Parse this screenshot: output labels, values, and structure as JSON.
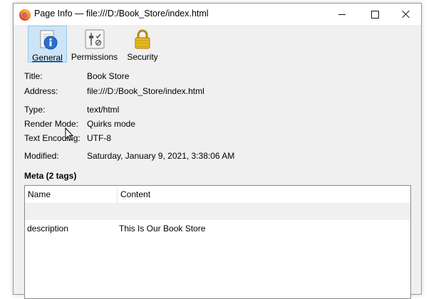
{
  "window": {
    "title": "Page Info — file:///D:/Book_Store/index.html"
  },
  "tabs": [
    {
      "label": "General",
      "icon": "info-icon",
      "selected": true
    },
    {
      "label": "Permissions",
      "icon": "permissions-icon",
      "selected": false
    },
    {
      "label": "Security",
      "icon": "lock-icon",
      "selected": false
    }
  ],
  "general": {
    "title_label": "Title:",
    "title_value": "Book Store",
    "address_label": "Address:",
    "address_value": "file:///D:/Book_Store/index.html",
    "type_label": "Type:",
    "type_value": "text/html",
    "render_label": "Render Mode:",
    "render_value": "Quirks mode",
    "encoding_label": "Text Encoding:",
    "encoding_value": "UTF-8",
    "modified_label": "Modified:",
    "modified_value": "Saturday, January 9, 2021, 3:38:06 AM"
  },
  "meta": {
    "heading": "Meta (2 tags)",
    "columns": [
      "Name",
      "Content"
    ],
    "rows": [
      {
        "name": "",
        "content": ""
      },
      {
        "name": "description",
        "content": "This Is Our Book Store"
      }
    ]
  },
  "colors": {
    "selected_tab_bg": "#cce4f7",
    "selected_tab_border": "#99c9ef",
    "dialog_bg": "#f0f0f0"
  }
}
